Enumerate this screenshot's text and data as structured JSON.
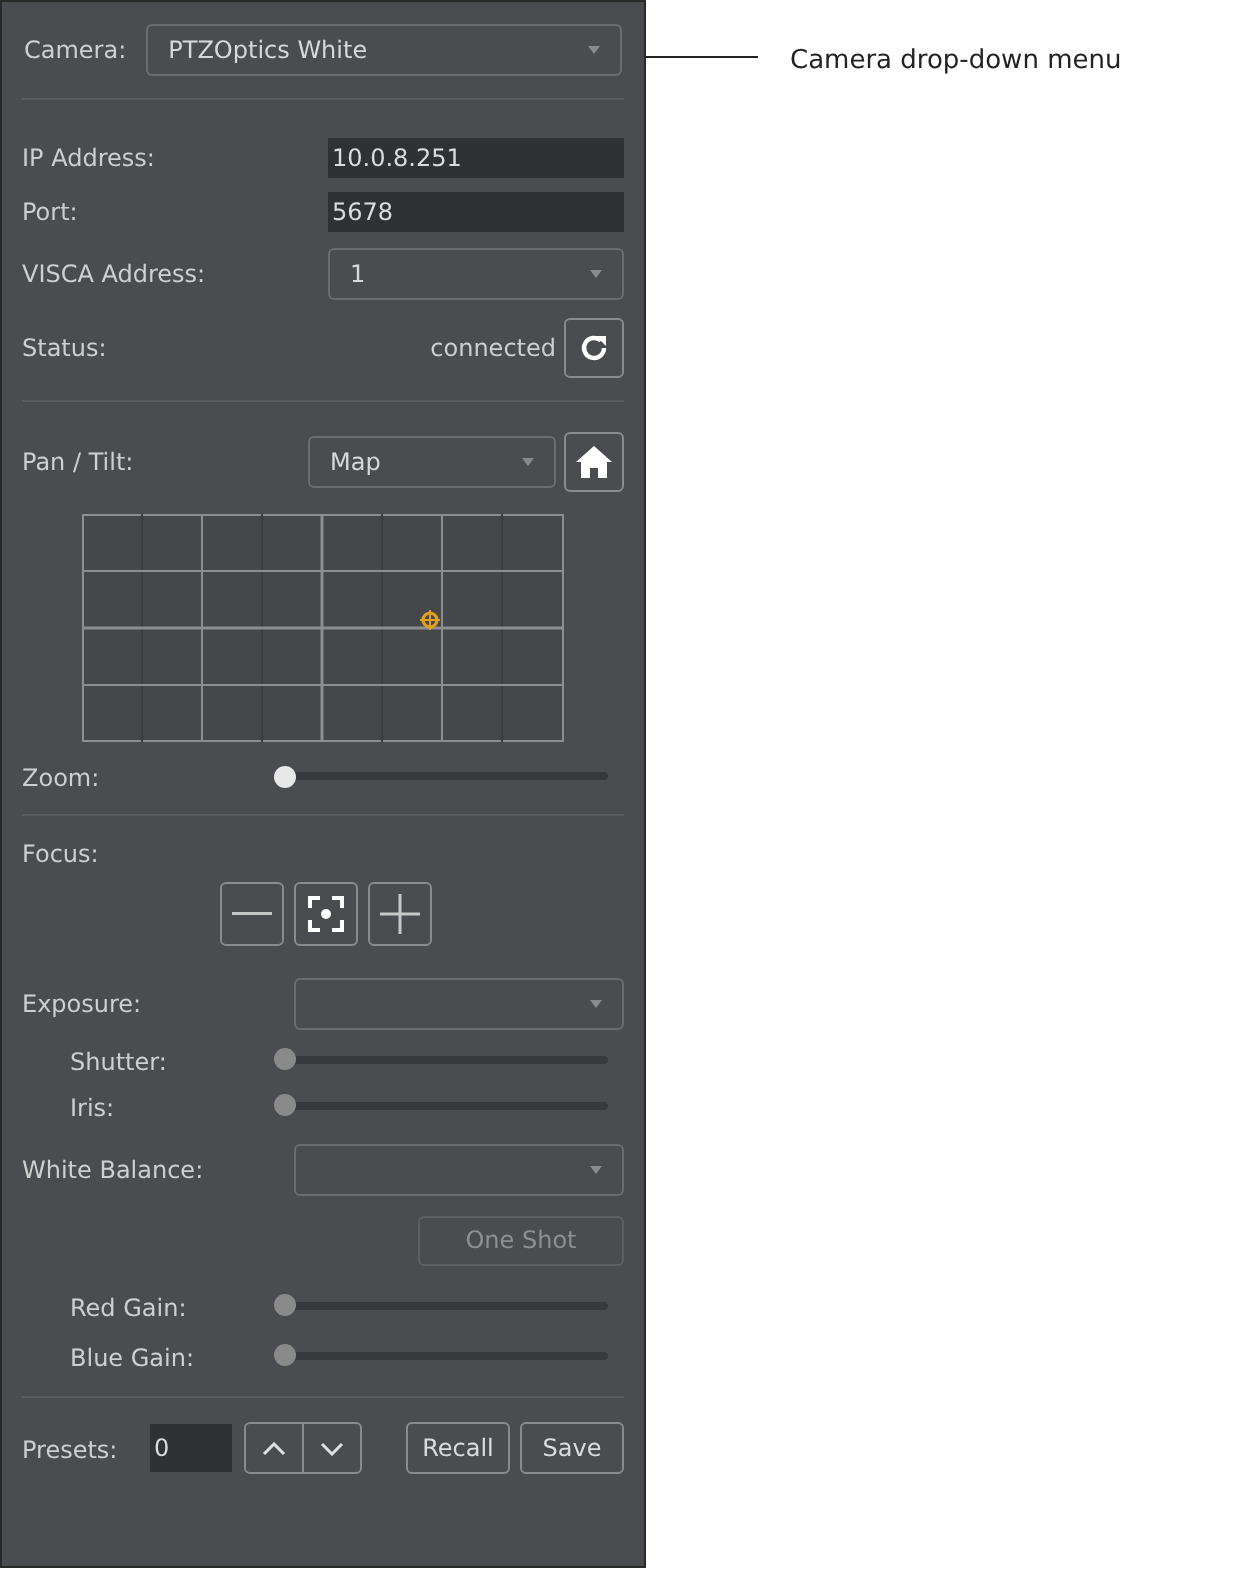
{
  "camera": {
    "label": "Camera:",
    "value": "PTZOptics White"
  },
  "connection": {
    "ip_label": "IP Address:",
    "ip_value": "10.0.8.251",
    "port_label": "Port:",
    "port_value": "5678",
    "visca_label": "VISCA Address:",
    "visca_value": "1",
    "status_label": "Status:",
    "status_value": "connected"
  },
  "pan_tilt": {
    "label": "Pan / Tilt:",
    "mode": "Map"
  },
  "zoom": {
    "label": "Zoom:",
    "level": 0,
    "disabled": false
  },
  "focus": {
    "label": "Focus:"
  },
  "exposure": {
    "label": "Exposure:",
    "sliders": [
      {
        "label": "Shutter:",
        "level": 0,
        "disabled": true
      },
      {
        "label": "Iris:",
        "level": 0,
        "disabled": true
      }
    ]
  },
  "white_balance": {
    "label": "White Balance:",
    "one_shot": {
      "label": "One Shot",
      "disabled": true
    },
    "sliders": [
      {
        "label": "Red Gain:",
        "level": 0,
        "disabled": true
      },
      {
        "label": "Blue Gain:",
        "level": 0,
        "disabled": true
      }
    ]
  },
  "presets": {
    "label": "Presets:",
    "value": "0",
    "buttons": [
      "Recall",
      "Save"
    ]
  },
  "callout": {
    "text": "Camera drop-down menu"
  }
}
